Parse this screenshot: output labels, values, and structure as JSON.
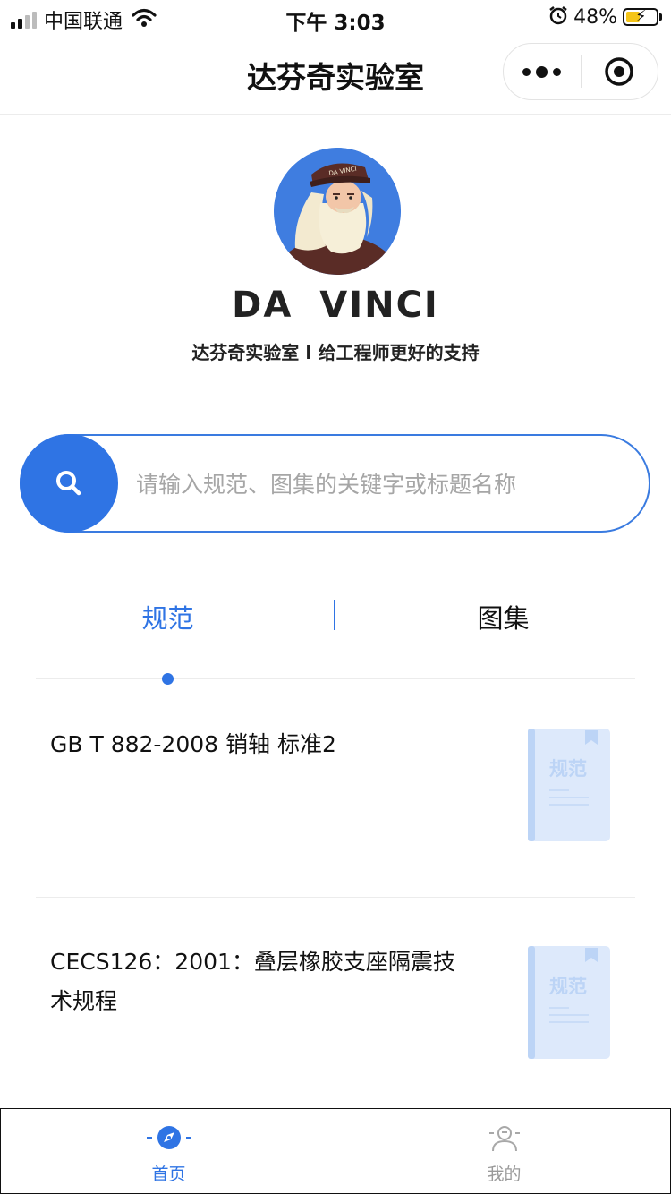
{
  "status_bar": {
    "carrier": "中国联通",
    "time": "下午 3:03",
    "battery_percent": "48%",
    "battery_level": 0.48
  },
  "nav": {
    "title": "达芬奇实验室"
  },
  "profile": {
    "brand": "DA VINCI",
    "tagline": "达芬奇实验室 I 给工程师更好的支持"
  },
  "search": {
    "placeholder": "请输入规范、图集的关键字或标题名称"
  },
  "tabs": [
    {
      "label": "规范",
      "active": true
    },
    {
      "label": "图集",
      "active": false
    }
  ],
  "list": [
    {
      "title": "GB T 882-2008 销轴 标准2",
      "thumb_label": "规范"
    },
    {
      "title": "CECS126：2001：叠层橡胶支座隔震技术规程",
      "thumb_label": "规范"
    }
  ],
  "tabbar": [
    {
      "label": "首页",
      "active": true
    },
    {
      "label": "我的",
      "active": false
    }
  ],
  "colors": {
    "accent": "#2f74e4",
    "inactive": "#9a9a9a",
    "thumb_bg": "#dde9fb"
  }
}
